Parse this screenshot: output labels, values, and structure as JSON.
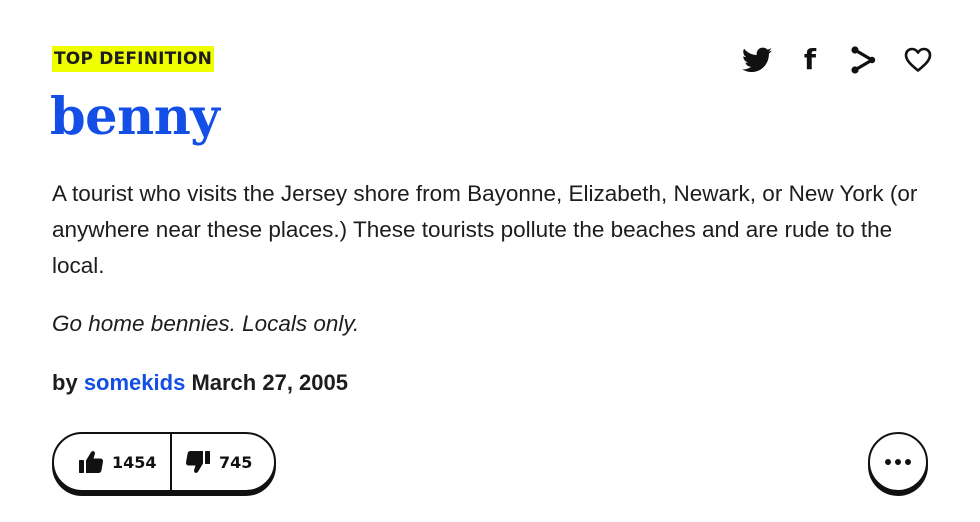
{
  "definition": {
    "badge": "TOP DEFINITION",
    "word": "benny",
    "meaning": "A tourist who visits the Jersey shore from Bayonne, Elizabeth, Newark, or New York (or anywhere near these places.) These tourists pollute the beaches and are rude to the local.",
    "example": "Go home bennies. Locals only.",
    "by_label": "by",
    "author": "somekids",
    "date": "March 27, 2005"
  },
  "share": {
    "icons": [
      "twitter-icon",
      "facebook-icon",
      "share-link-icon",
      "heart-icon"
    ]
  },
  "votes": {
    "up_count": "1454",
    "down_count": "745"
  },
  "colors": {
    "accent": "#134fe6",
    "badge_bg": "#efff00",
    "text": "#1d1d1d"
  }
}
